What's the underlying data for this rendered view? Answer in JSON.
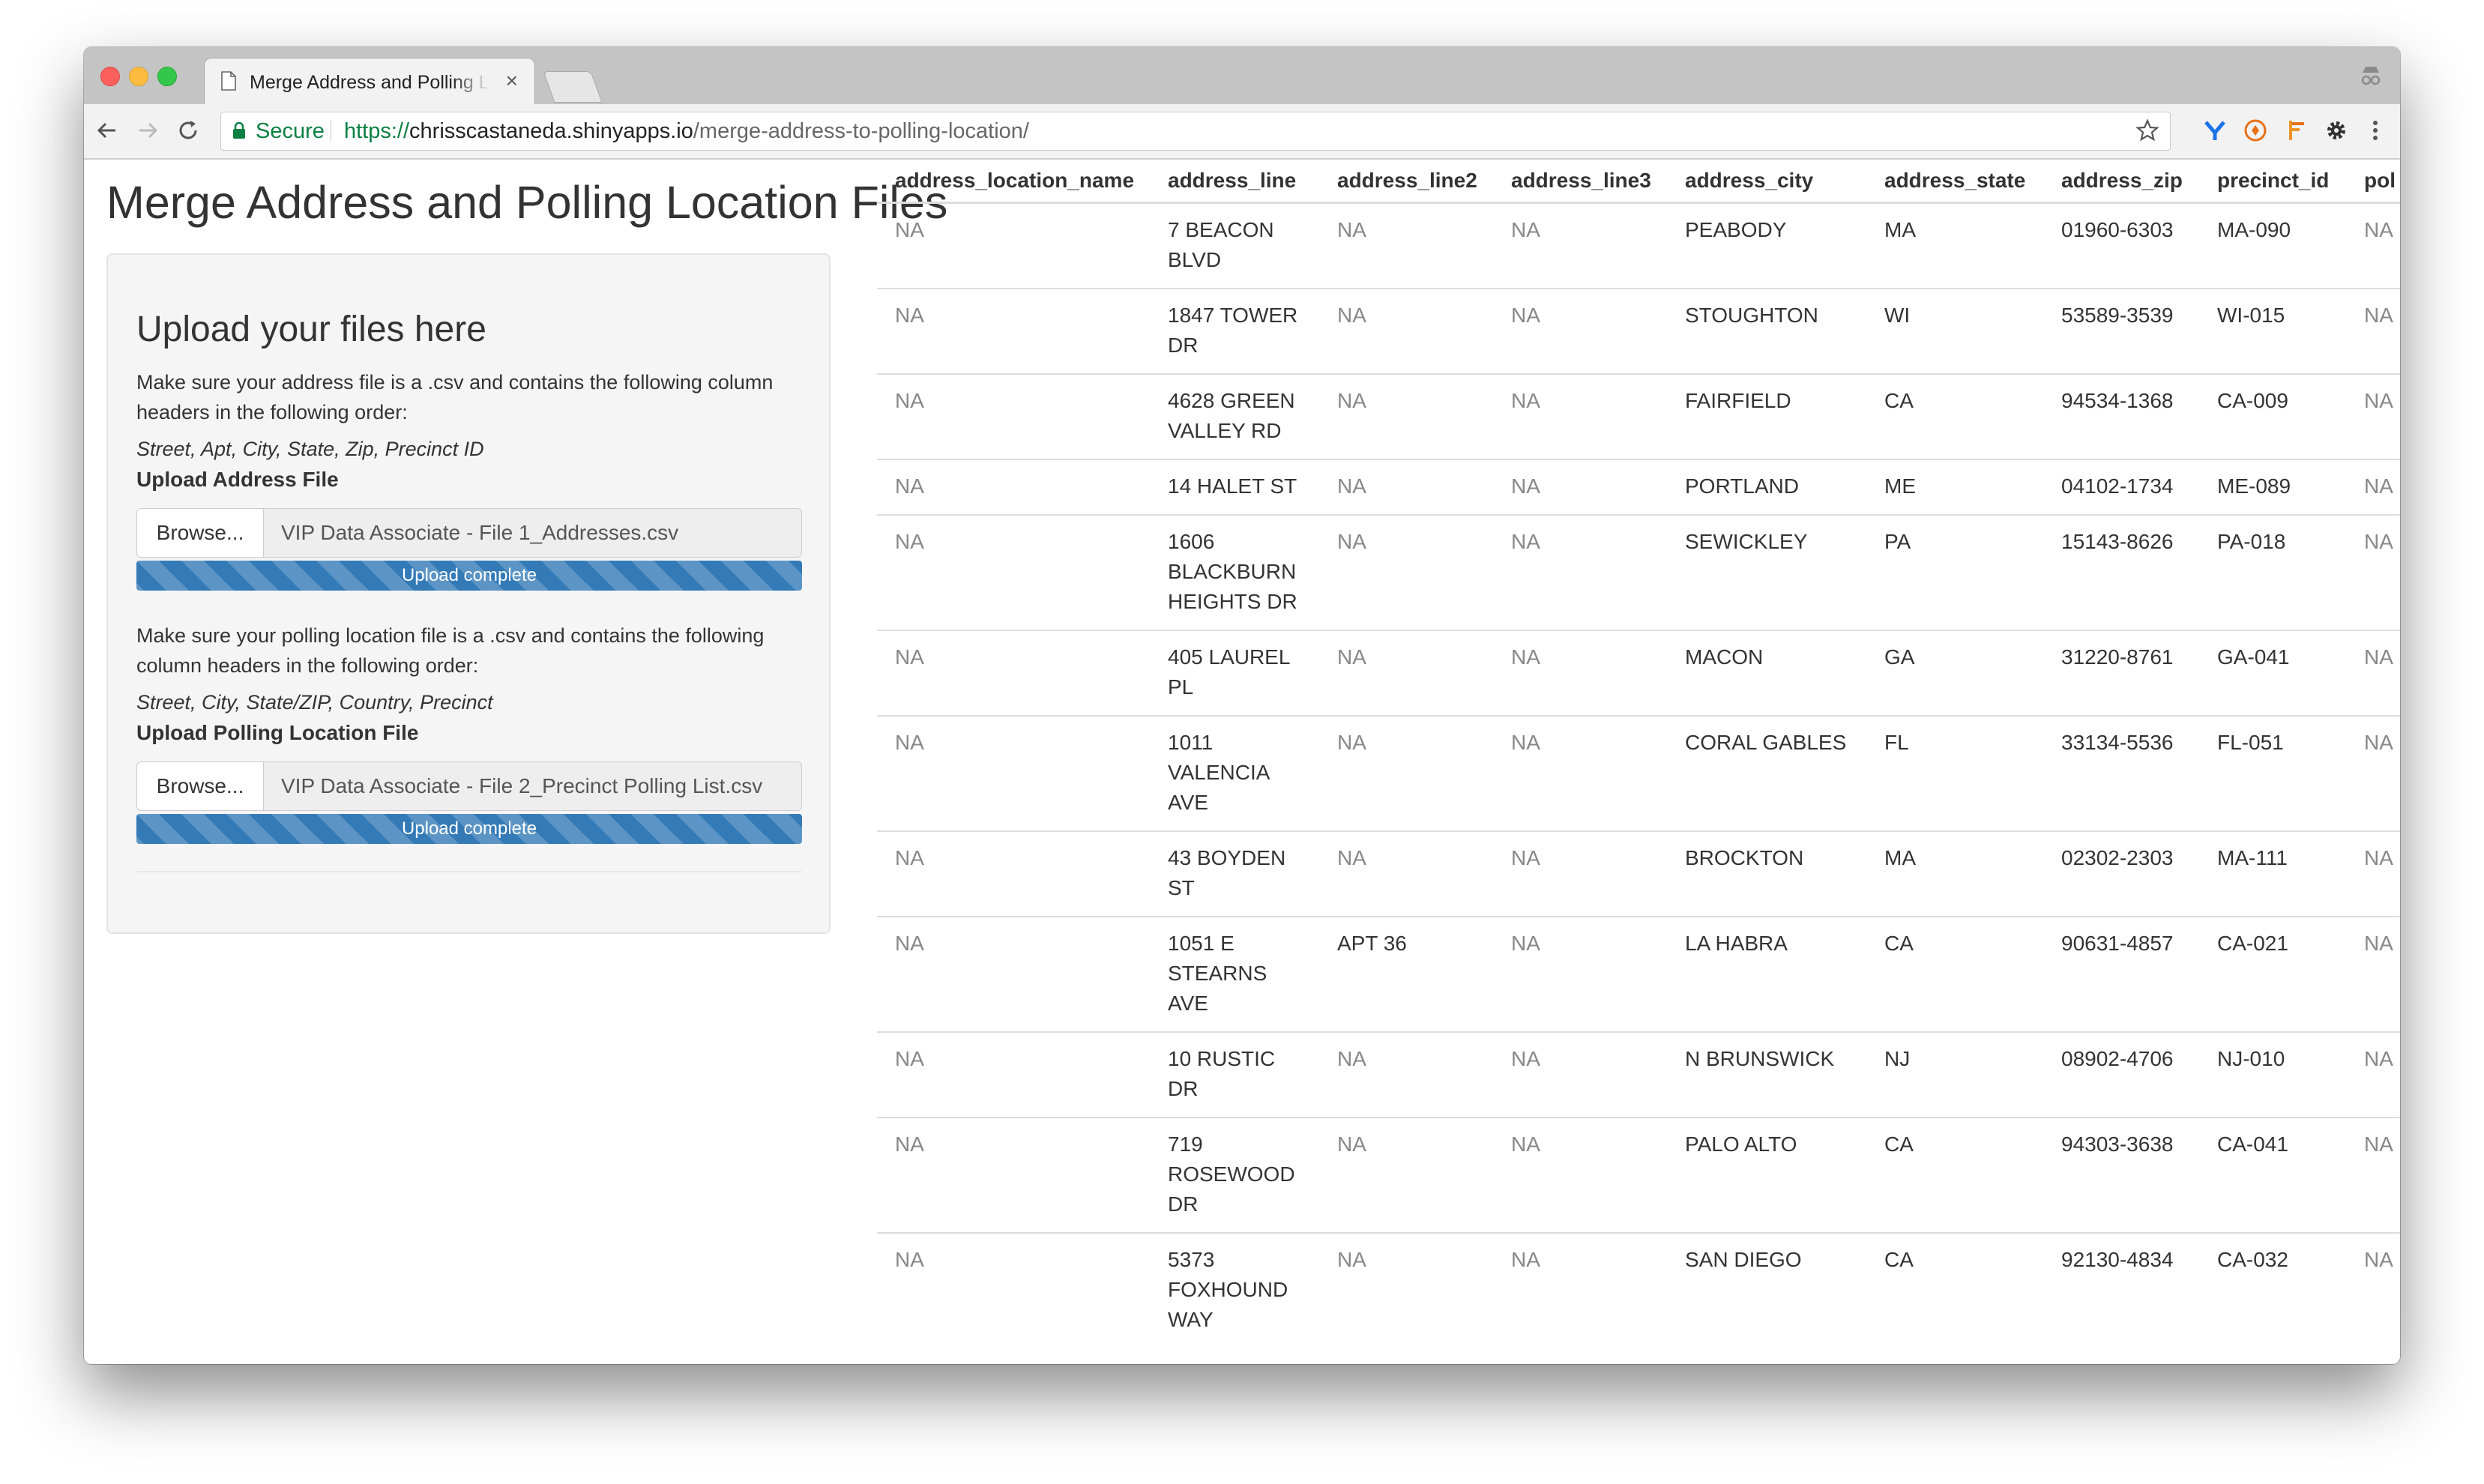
{
  "browser": {
    "tab_title": "Merge Address and Polling Location Files",
    "tab_close": "×",
    "secure_label": "Secure",
    "url_scheme": "https://",
    "url_host": "chrisscastaneda.shinyapps.io",
    "url_path": "/merge-address-to-polling-location/",
    "colors": {
      "secure": "#0b8043",
      "progress": "#337ab7"
    },
    "icons": [
      "back-icon",
      "forward-icon",
      "reload-icon",
      "lock-icon",
      "star-icon",
      "extension-y-icon",
      "extension-circle-icon",
      "extension-flag-icon",
      "gear-icon",
      "kebab-menu-icon",
      "incognito-icon",
      "document-icon"
    ]
  },
  "page": {
    "title": "Merge Address and Polling Location Files"
  },
  "sidebar": {
    "heading": "Upload your files here",
    "address_instructions": "Make sure your address file is a .csv and contains the following column headers in the following order:",
    "address_columns": "Street, Apt, City, State, Zip, Precinct ID",
    "address_label": "Upload Address File",
    "address_browse": "Browse...",
    "address_filename": "VIP Data Associate - File 1_Addresses.csv",
    "address_progress": "Upload complete",
    "address_progress_value": 1.0,
    "polling_instructions": "Make sure your polling location file is a .csv and contains the following column headers in the following order:",
    "polling_columns": "Street, City, State/ZIP, Country, Precinct",
    "polling_label": "Upload Polling Location File",
    "polling_browse": "Browse...",
    "polling_filename": "VIP Data Associate - File 2_Precinct Polling List.csv",
    "polling_progress": "Upload complete",
    "polling_progress_value": 1.0
  },
  "table": {
    "headers": [
      "address_location_name",
      "address_line",
      "address_line2",
      "address_line3",
      "address_city",
      "address_state",
      "address_zip",
      "precinct_id",
      "pol"
    ],
    "rows": [
      [
        "NA",
        "7 BEACON BLVD",
        "NA",
        "NA",
        "PEABODY",
        "MA",
        "01960-6303",
        "MA-090",
        "NA"
      ],
      [
        "NA",
        "1847 TOWER DR",
        "NA",
        "NA",
        "STOUGHTON",
        "WI",
        "53589-3539",
        "WI-015",
        "NA"
      ],
      [
        "NA",
        "4628 GREEN VALLEY RD",
        "NA",
        "NA",
        "FAIRFIELD",
        "CA",
        "94534-1368",
        "CA-009",
        "NA"
      ],
      [
        "NA",
        "14 HALET ST",
        "NA",
        "NA",
        "PORTLAND",
        "ME",
        "04102-1734",
        "ME-089",
        "NA"
      ],
      [
        "NA",
        "1606 BLACKBURN HEIGHTS DR",
        "NA",
        "NA",
        "SEWICKLEY",
        "PA",
        "15143-8626",
        "PA-018",
        "NA"
      ],
      [
        "NA",
        "405 LAUREL PL",
        "NA",
        "NA",
        "MACON",
        "GA",
        "31220-8761",
        "GA-041",
        "NA"
      ],
      [
        "NA",
        "1011 VALENCIA AVE",
        "NA",
        "NA",
        "CORAL GABLES",
        "FL",
        "33134-5536",
        "FL-051",
        "NA"
      ],
      [
        "NA",
        "43 BOYDEN ST",
        "NA",
        "NA",
        "BROCKTON",
        "MA",
        "02302-2303",
        "MA-111",
        "NA"
      ],
      [
        "NA",
        "1051 E STEARNS AVE",
        "APT 36",
        "NA",
        "LA HABRA",
        "CA",
        "90631-4857",
        "CA-021",
        "NA"
      ],
      [
        "NA",
        "10 RUSTIC DR",
        "NA",
        "NA",
        "N BRUNSWICK",
        "NJ",
        "08902-4706",
        "NJ-010",
        "NA"
      ],
      [
        "NA",
        "719 ROSEWOOD DR",
        "NA",
        "NA",
        "PALO ALTO",
        "CA",
        "94303-3638",
        "CA-041",
        "NA"
      ],
      [
        "NA",
        "5373 FOXHOUND WAY",
        "NA",
        "NA",
        "SAN DIEGO",
        "CA",
        "92130-4834",
        "CA-032",
        "NA"
      ]
    ]
  }
}
